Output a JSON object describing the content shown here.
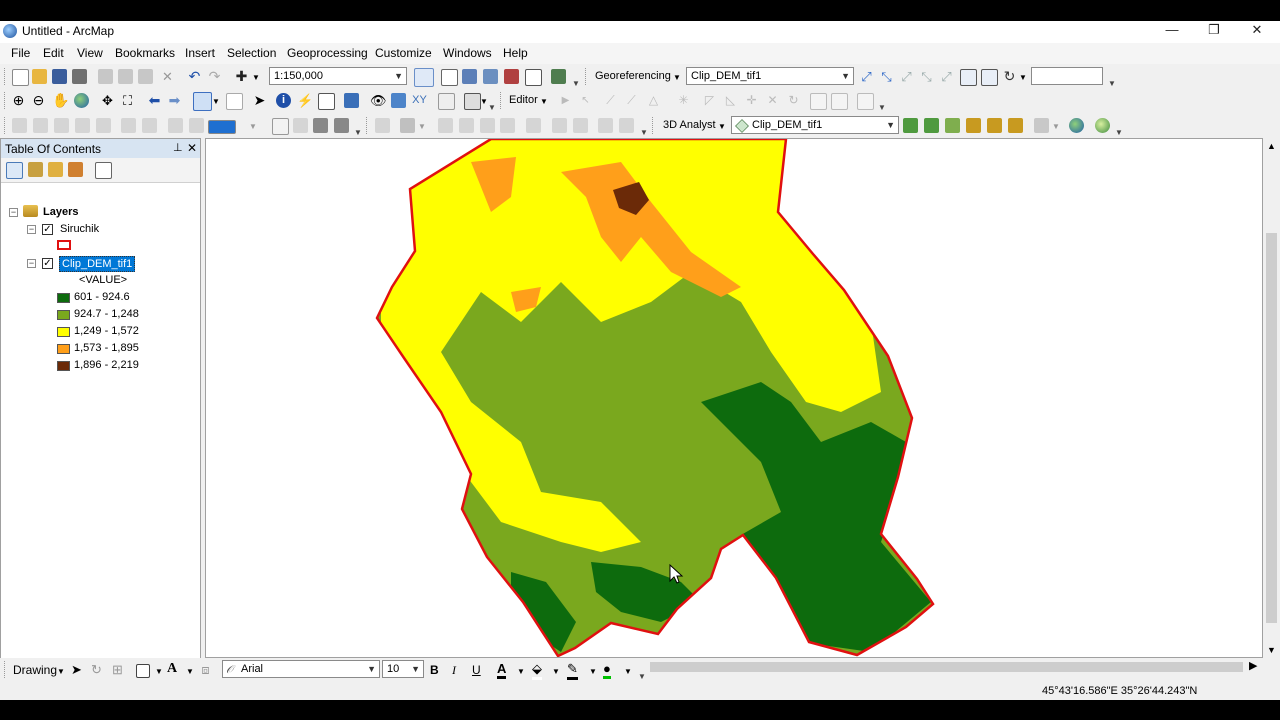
{
  "window": {
    "title": "Untitled - ArcMap",
    "minimize": "—",
    "restore": "❐",
    "close": "✕"
  },
  "menu": [
    "File",
    "Edit",
    "View",
    "Bookmarks",
    "Insert",
    "Selection",
    "Geoprocessing",
    "Customize",
    "Windows",
    "Help"
  ],
  "toolbar": {
    "scale": "1:150,000",
    "georef_label": "Georeferencing",
    "georef_layer": "Clip_DEM_tif1",
    "editor_label": "Editor",
    "analyst_label": "3D Analyst",
    "analyst_layer": "Clip_DEM_tif1"
  },
  "toc": {
    "title": "Table Of Contents",
    "pin": "⊥",
    "close": "✕",
    "root": "Layers",
    "layers": [
      {
        "name": "Siruchik"
      },
      {
        "name": "Clip_DEM_tif1",
        "field": "<VALUE>"
      }
    ],
    "legend": [
      {
        "label": "601 - 924.6",
        "color": "#0d6b0d"
      },
      {
        "label": "924.7 - 1,248",
        "color": "#7aa81e"
      },
      {
        "label": "1,249 - 1,572",
        "color": "#ffff00"
      },
      {
        "label": "1,573 - 1,895",
        "color": "#ff9f1a"
      },
      {
        "label": "1,896 - 2,219",
        "color": "#6b2a08"
      }
    ],
    "outline_color": "#e01010"
  },
  "drawing": {
    "label": "Drawing",
    "font": "Arial",
    "size": "10",
    "bold": "B",
    "italic": "I",
    "underline": "U",
    "text_tool": "A"
  },
  "status": {
    "coords": "45°43'16.586\"E  35°26'44.243\"N"
  }
}
